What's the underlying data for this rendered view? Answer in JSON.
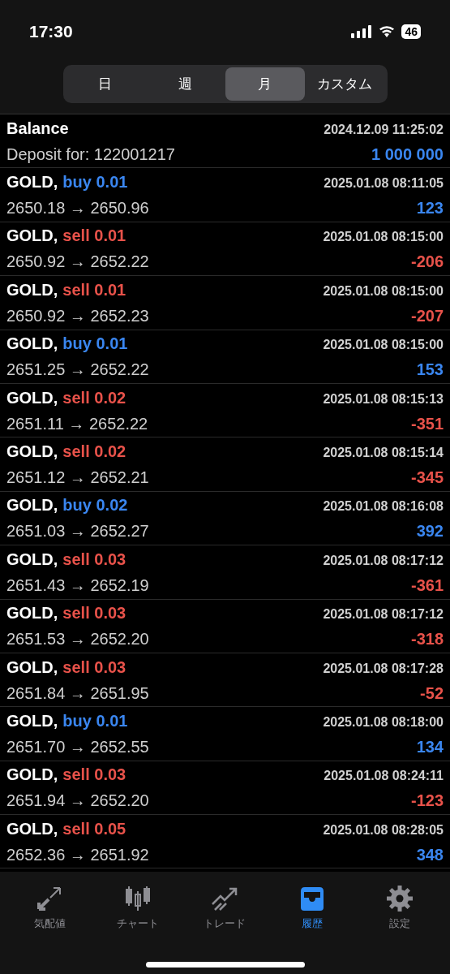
{
  "status_bar": {
    "time": "17:30",
    "battery": "46"
  },
  "period_tabs": [
    {
      "label": "日",
      "selected": false
    },
    {
      "label": "週",
      "selected": false
    },
    {
      "label": "月",
      "selected": true
    },
    {
      "label": "カスタム",
      "selected": false
    }
  ],
  "history": [
    {
      "kind": "balance",
      "title": "Balance",
      "time": "2024.12.09 11:25:02",
      "detail": "Deposit for: 122001217",
      "amount": "1 000 000",
      "loss": false
    },
    {
      "kind": "buy",
      "symbol": "GOLD,",
      "volume": "buy 0.01",
      "time": "2025.01.08 08:11:05",
      "detail": "2650.18 → 2650.96",
      "amount": "123",
      "loss": false
    },
    {
      "kind": "sell",
      "symbol": "GOLD,",
      "volume": "sell 0.01",
      "time": "2025.01.08 08:15:00",
      "detail": "2650.92 → 2652.22",
      "amount": "-206",
      "loss": true
    },
    {
      "kind": "sell",
      "symbol": "GOLD,",
      "volume": "sell 0.01",
      "time": "2025.01.08 08:15:00",
      "detail": "2650.92 → 2652.23",
      "amount": "-207",
      "loss": true
    },
    {
      "kind": "buy",
      "symbol": "GOLD,",
      "volume": "buy 0.01",
      "time": "2025.01.08 08:15:00",
      "detail": "2651.25 → 2652.22",
      "amount": "153",
      "loss": false
    },
    {
      "kind": "sell",
      "symbol": "GOLD,",
      "volume": "sell 0.02",
      "time": "2025.01.08 08:15:13",
      "detail": "2651.11 → 2652.22",
      "amount": "-351",
      "loss": true
    },
    {
      "kind": "sell",
      "symbol": "GOLD,",
      "volume": "sell 0.02",
      "time": "2025.01.08 08:15:14",
      "detail": "2651.12 → 2652.21",
      "amount": "-345",
      "loss": true
    },
    {
      "kind": "buy",
      "symbol": "GOLD,",
      "volume": "buy 0.02",
      "time": "2025.01.08 08:16:08",
      "detail": "2651.03 → 2652.27",
      "amount": "392",
      "loss": false
    },
    {
      "kind": "sell",
      "symbol": "GOLD,",
      "volume": "sell 0.03",
      "time": "2025.01.08 08:17:12",
      "detail": "2651.43 → 2652.19",
      "amount": "-361",
      "loss": true
    },
    {
      "kind": "sell",
      "symbol": "GOLD,",
      "volume": "sell 0.03",
      "time": "2025.01.08 08:17:12",
      "detail": "2651.53 → 2652.20",
      "amount": "-318",
      "loss": true
    },
    {
      "kind": "sell",
      "symbol": "GOLD,",
      "volume": "sell 0.03",
      "time": "2025.01.08 08:17:28",
      "detail": "2651.84 → 2651.95",
      "amount": "-52",
      "loss": true
    },
    {
      "kind": "buy",
      "symbol": "GOLD,",
      "volume": "buy 0.01",
      "time": "2025.01.08 08:18:00",
      "detail": "2651.70 → 2652.55",
      "amount": "134",
      "loss": false
    },
    {
      "kind": "sell",
      "symbol": "GOLD,",
      "volume": "sell 0.03",
      "time": "2025.01.08 08:24:11",
      "detail": "2651.94 → 2652.20",
      "amount": "-123",
      "loss": true
    },
    {
      "kind": "sell",
      "symbol": "GOLD,",
      "volume": "sell 0.05",
      "time": "2025.01.08 08:28:05",
      "detail": "2652.36 → 2651.92",
      "amount": "348",
      "loss": false
    }
  ],
  "tab_bar": [
    {
      "label": "気配値",
      "selected": false
    },
    {
      "label": "チャート",
      "selected": false
    },
    {
      "label": "トレード",
      "selected": false
    },
    {
      "label": "履歴",
      "selected": true
    },
    {
      "label": "設定",
      "selected": false
    }
  ]
}
